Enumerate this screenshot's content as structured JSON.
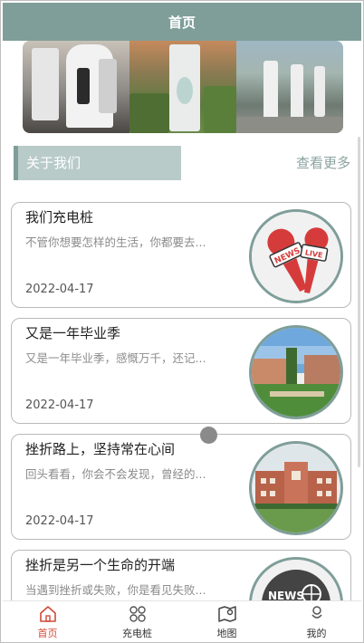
{
  "header": {
    "title": "首页"
  },
  "section": {
    "title": "关于我们",
    "more_label": "查看更多"
  },
  "articles": [
    {
      "title": "我们充电桩",
      "desc": "不管你想要怎样的生活，你都要去...",
      "date": "2022-04-17",
      "thumb": "news-live-microphone-icon"
    },
    {
      "title": "又是一年毕业季",
      "desc": "又是一年毕业季，感慨万千，还记...",
      "date": "2022-04-17",
      "thumb": "campus-photo"
    },
    {
      "title": "挫折路上，坚持常在心间",
      "desc": "回头看看，你会不会发现，曾经的...",
      "date": "2022-04-17",
      "thumb": "campus-building-photo"
    },
    {
      "title": "挫折是另一个生命的开端",
      "desc": "当遇到挫折或失败，你是看见失败...",
      "date": "",
      "thumb": "news-globe-icon"
    }
  ],
  "tabs": [
    {
      "label": "首页",
      "icon": "home-icon",
      "active": true
    },
    {
      "label": "充电桩",
      "icon": "grid-icon",
      "active": false
    },
    {
      "label": "地图",
      "icon": "map-icon",
      "active": false
    },
    {
      "label": "我的",
      "icon": "user-icon",
      "active": false
    }
  ],
  "colors": {
    "accent": "#7f9e99",
    "active_tab": "#d04a3a"
  }
}
